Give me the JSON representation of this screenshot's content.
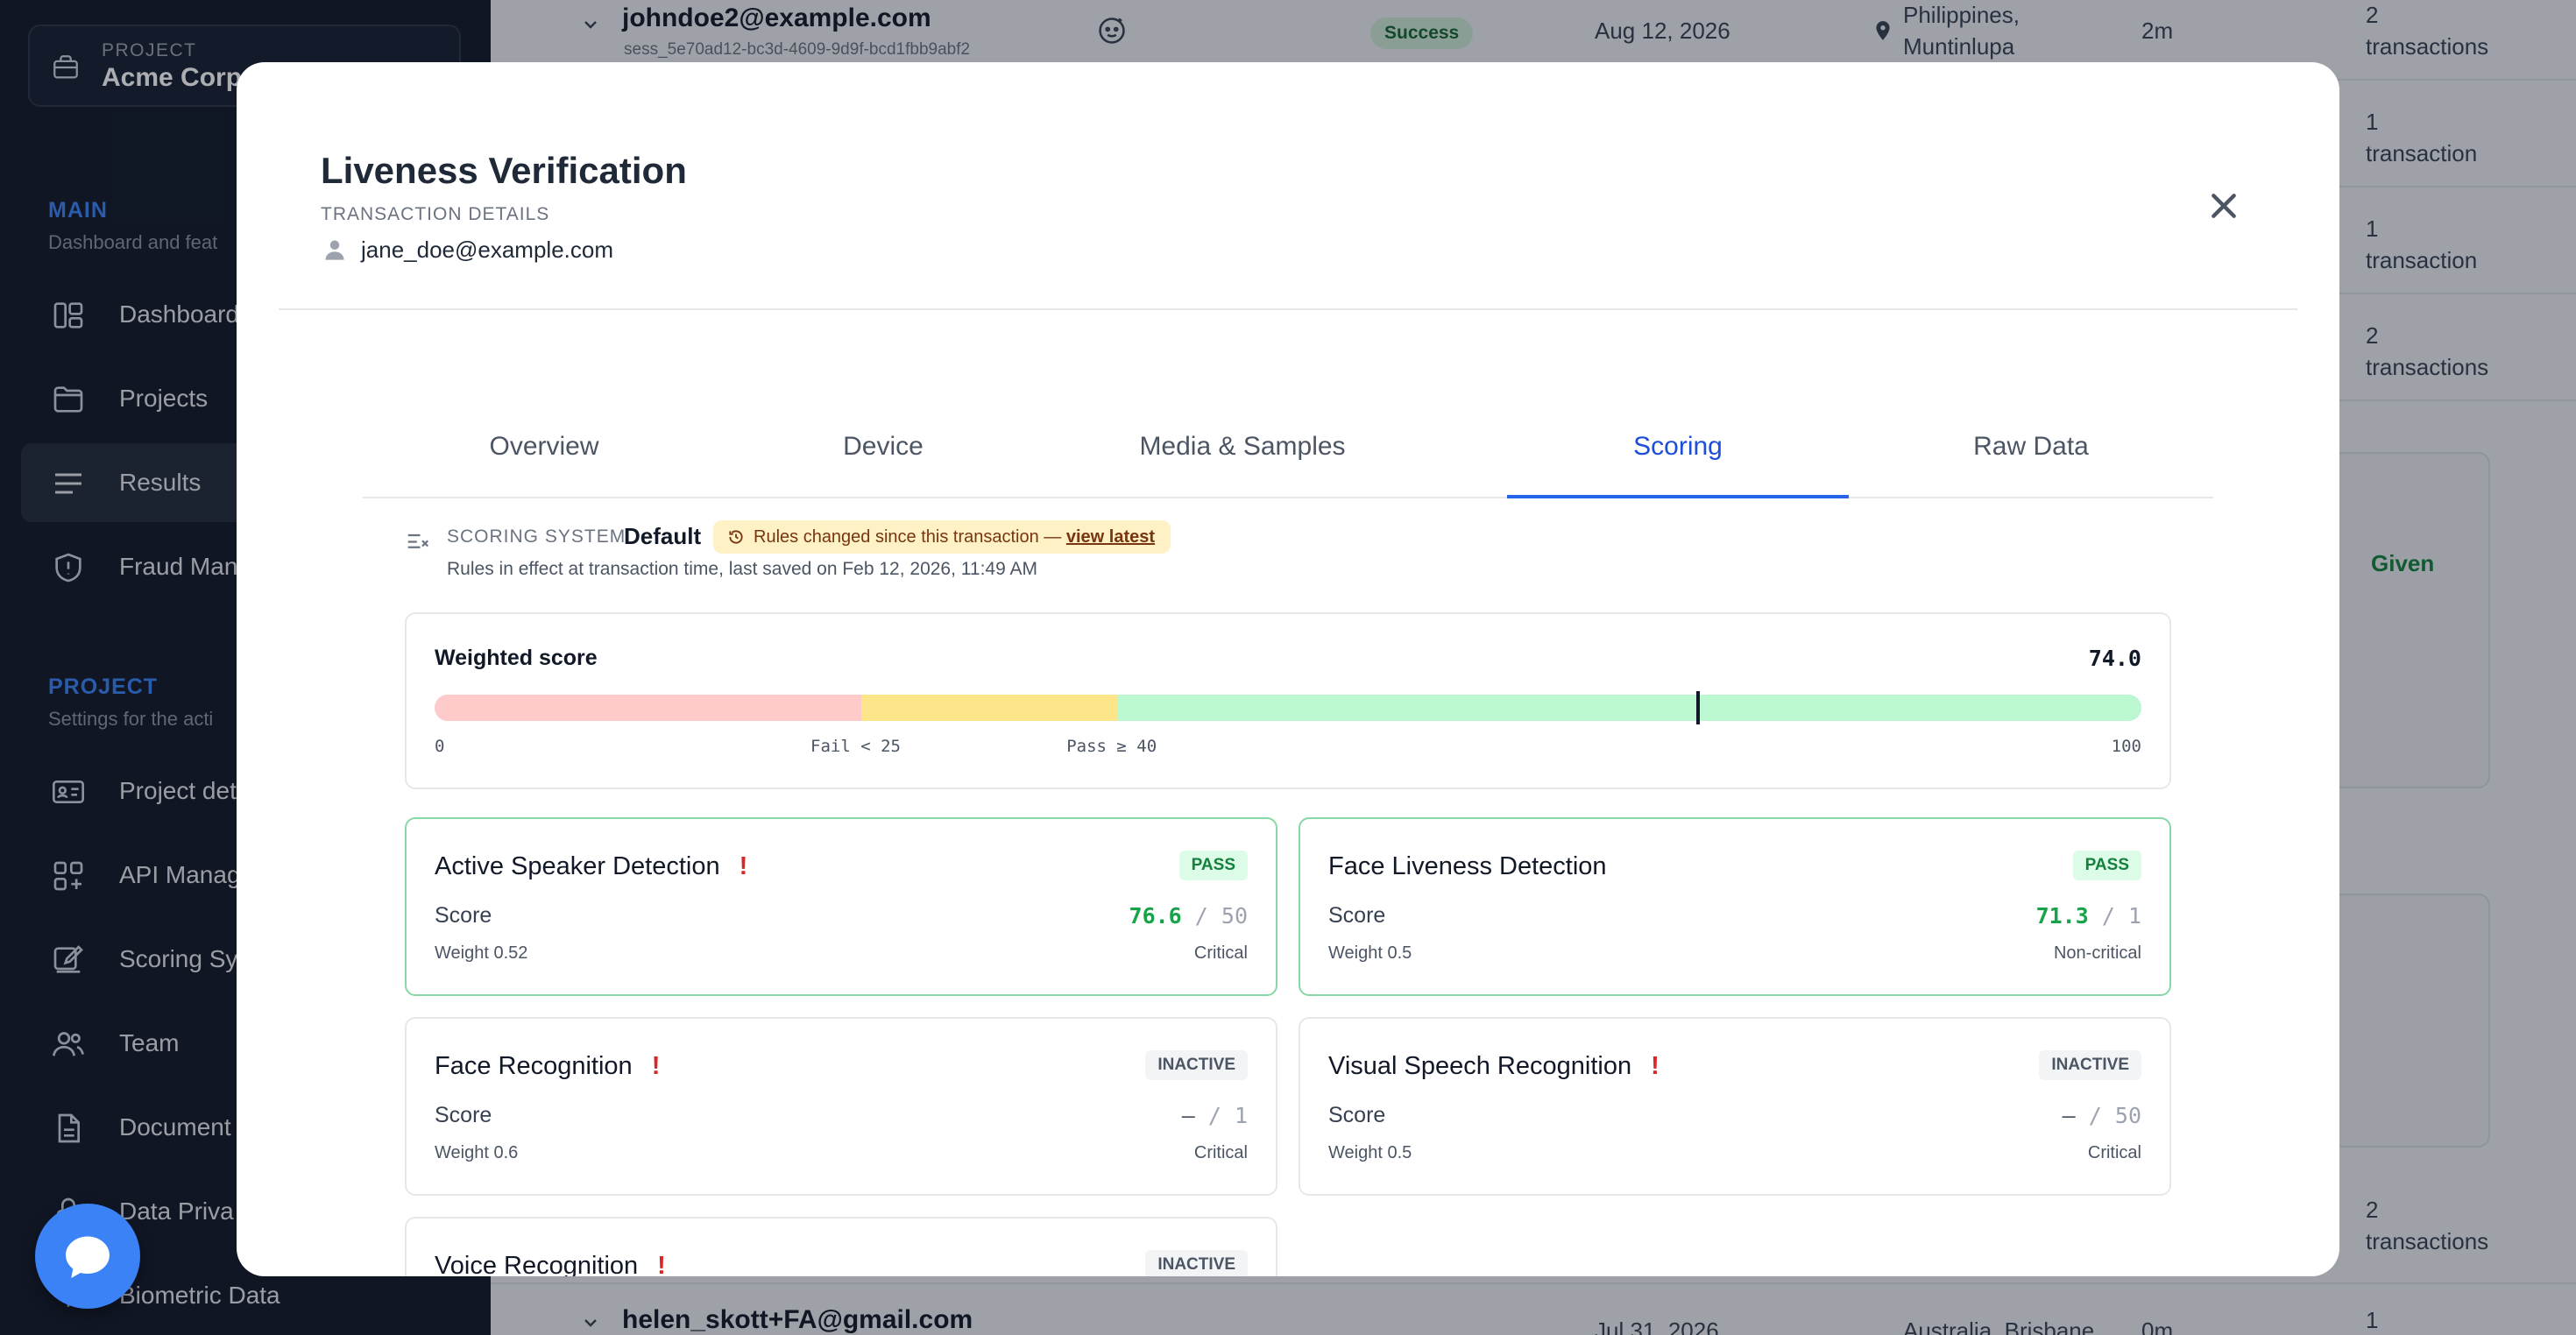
{
  "sidebar": {
    "project_label": "PROJECT",
    "project_name": "Acme Corp",
    "main_title": "MAIN",
    "main_sub": "Dashboard and feat",
    "main_items": [
      {
        "label": "Dashboard",
        "icon": "dashboard-icon"
      },
      {
        "label": "Projects",
        "icon": "folder-icon"
      },
      {
        "label": "Results",
        "icon": "list-icon",
        "active": true
      },
      {
        "label": "Fraud Man",
        "icon": "shield-icon"
      }
    ],
    "project_title": "PROJECT",
    "project_sub": "Settings for the acti",
    "project_items": [
      {
        "label": "Project det",
        "icon": "id-card-icon"
      },
      {
        "label": "API Manag",
        "icon": "api-icon"
      },
      {
        "label": "Scoring Sy",
        "icon": "edit-icon"
      },
      {
        "label": "Team",
        "icon": "team-icon"
      },
      {
        "label": "Document",
        "icon": "document-icon"
      },
      {
        "label": "Data Priva",
        "icon": "lock-icon"
      },
      {
        "label": "Biometric Data",
        "icon": "fingerprint-icon"
      }
    ]
  },
  "background": {
    "row1": {
      "email": "johndoe2@example.com",
      "session": "sess_5e70ad12-bc3d-4609-9d9f-bcd1fbb9abf2",
      "status": "Success",
      "date": "Aug 12, 2026",
      "location_line1": "Philippines,",
      "location_line2": "Muntinlupa",
      "duration": "2m",
      "count_num": "2",
      "count_label": "transactions"
    },
    "row2": {
      "count_num": "1",
      "count_label": "transaction"
    },
    "row3": {
      "count_num": "1",
      "count_label": "transaction"
    },
    "row4": {
      "count_num": "2",
      "count_label": "transactions"
    },
    "given": "Given",
    "row5": {
      "count_num": "2",
      "count_label": "transactions"
    },
    "row6": {
      "email": "helen_skott+FA@gmail.com",
      "date": "Jul 31, 2026",
      "location": "Australia, Brisbane",
      "duration": "0m",
      "count_num": "1"
    }
  },
  "modal": {
    "title": "Liveness Verification",
    "subtitle": "TRANSACTION DETAILS",
    "user": "jane_doe@example.com",
    "tabs": [
      {
        "label": "Overview",
        "active": false
      },
      {
        "label": "Device",
        "active": false
      },
      {
        "label": "Media & Samples",
        "active": false
      },
      {
        "label": "Scoring",
        "active": true
      },
      {
        "label": "Raw Data",
        "active": false
      }
    ],
    "scoring_system": {
      "label": "SCORING SYSTEM",
      "name": "Default",
      "warning": "Rules changed since this transaction —",
      "warning_link": "view latest",
      "note": "Rules in effect at transaction time, last saved on Feb 12, 2026, 11:49 AM"
    },
    "weighted": {
      "title": "Weighted score",
      "value": "74.0",
      "score": 74,
      "fail_threshold": 25,
      "pass_threshold": 40,
      "min_label": "0",
      "fail_label": "Fail < 25",
      "pass_label": "Pass ≥ 40",
      "max_label": "100",
      "colors": {
        "fail": "#fecaca",
        "warn": "#fde68a",
        "pass": "#bbf7d0"
      }
    },
    "score_cards": [
      {
        "name": "Active Speaker Detection",
        "flag": "!",
        "status": "PASS",
        "score_label": "Score",
        "score": "76.6",
        "threshold": "50",
        "weight": "Weight 0.52",
        "criticality": "Critical"
      },
      {
        "name": "Face Liveness Detection",
        "flag": "",
        "status": "PASS",
        "score_label": "Score",
        "score": "71.3",
        "threshold": "1",
        "weight": "Weight 0.5",
        "criticality": "Non-critical"
      },
      {
        "name": "Face Recognition",
        "flag": "!",
        "status": "INACTIVE",
        "score_label": "Score",
        "score": "–",
        "threshold": "1",
        "weight": "Weight 0.6",
        "criticality": "Critical"
      },
      {
        "name": "Visual Speech Recognition",
        "flag": "!",
        "status": "INACTIVE",
        "score_label": "Score",
        "score": "–",
        "threshold": "50",
        "weight": "Weight 0.5",
        "criticality": "Critical"
      },
      {
        "name": "Voice Recognition",
        "flag": "!",
        "status": "INACTIVE"
      }
    ]
  }
}
